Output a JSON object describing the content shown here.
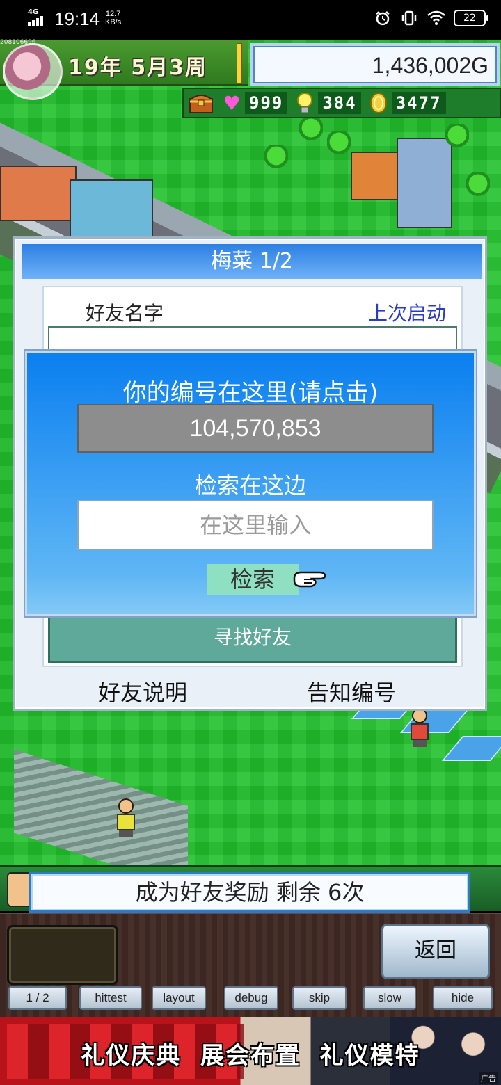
{
  "status_bar": {
    "network": "4G",
    "time": "19:14",
    "speed_value": "12.7",
    "speed_unit": "KB/s",
    "battery": "22"
  },
  "hud": {
    "game_id_tag": "208106696",
    "date": "19年 5月3周",
    "money": "1,436,002G",
    "hearts": "999",
    "ideas": "384",
    "coins": "3477"
  },
  "friend_panel": {
    "title": "梅菜 1/2",
    "col_name": "好友名字",
    "col_last": "上次启动",
    "find_button": "寻找好友",
    "explain_button": "好友说明",
    "share_button": "告知编号"
  },
  "id_dialog": {
    "title": "你的编号在这里(请点击)",
    "id_number": "104,570,853",
    "search_label": "检索在这边",
    "search_placeholder": "在这里输入",
    "search_button": "检索"
  },
  "reward_banner": "成为好友奖励 剩余 6次",
  "bottom": {
    "back_button": "返回",
    "debug_buttons": [
      "1 / 2",
      "hittest",
      "layout",
      "debug",
      "skip",
      "slow",
      "hide"
    ]
  },
  "ad": {
    "text": "礼仪庆典  展会布置  礼仪模特",
    "tag": "广告"
  },
  "colors": {
    "grass": "#22c12c",
    "dialog_blue": "#0a7ff0",
    "header_blue": "#2c7fe3",
    "find_green": "#5fa99a"
  }
}
